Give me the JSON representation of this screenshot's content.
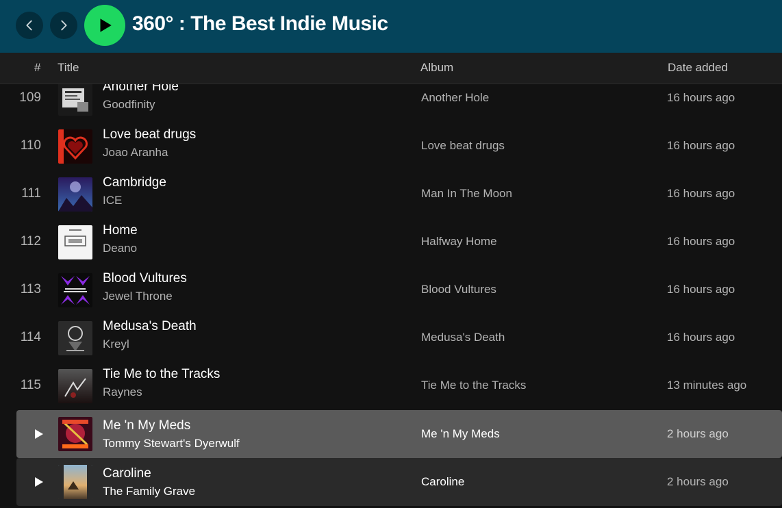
{
  "header": {
    "title": "360° : The Best Indie Music"
  },
  "columns": {
    "num": "#",
    "title": "Title",
    "album": "Album",
    "date": "Date added"
  },
  "tracks": [
    {
      "num": "109",
      "title": "Another Hole",
      "artist": "Goodfinity",
      "album": "Another Hole",
      "date": "16 hours ago"
    },
    {
      "num": "110",
      "title": "Love beat drugs",
      "artist": "Joao Aranha",
      "album": "Love beat drugs",
      "date": "16 hours ago"
    },
    {
      "num": "111",
      "title": "Cambridge",
      "artist": "ICE",
      "album": "Man In The Moon",
      "date": "16 hours ago"
    },
    {
      "num": "112",
      "title": "Home",
      "artist": "Deano",
      "album": "Halfway Home",
      "date": "16 hours ago"
    },
    {
      "num": "113",
      "title": "Blood Vultures",
      "artist": "Jewel Throne",
      "album": "Blood Vultures",
      "date": "16 hours ago"
    },
    {
      "num": "114",
      "title": "Medusa's Death",
      "artist": "Kreyl",
      "album": "Medusa's Death",
      "date": "16 hours ago"
    },
    {
      "num": "115",
      "title": "Tie Me to the Tracks",
      "artist": "Raynes",
      "album": "Tie Me to the Tracks",
      "date": "13 minutes ago"
    },
    {
      "num": "",
      "title": "Me 'n My Meds",
      "artist": "Tommy Stewart's Dyerwulf",
      "album": "Me 'n My Meds",
      "date": "2 hours ago"
    },
    {
      "num": "",
      "title": "Caroline",
      "artist": "The Family Grave",
      "album": "Caroline",
      "date": "2 hours ago"
    }
  ],
  "icons": {
    "back": "chevron-left-icon",
    "forward": "chevron-right-icon",
    "play": "play-icon"
  },
  "colors": {
    "topbar": "#05445b",
    "play_button": "#1ed760",
    "background": "#121212"
  }
}
